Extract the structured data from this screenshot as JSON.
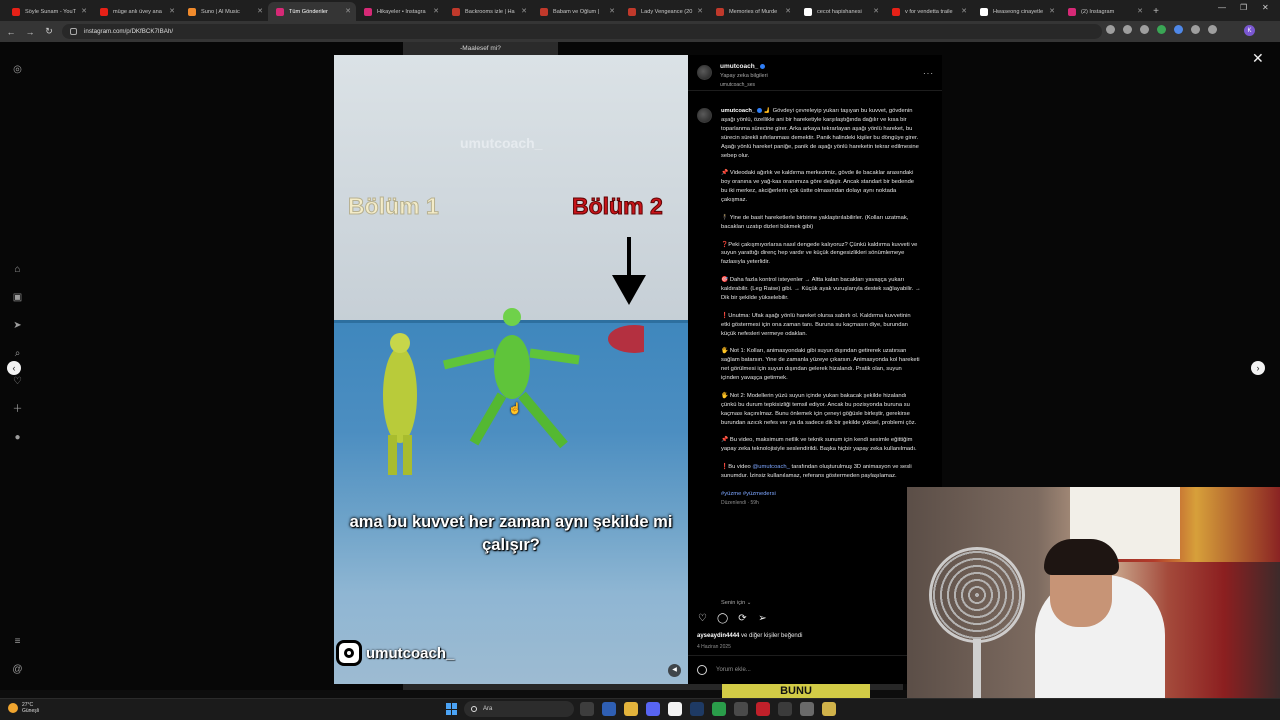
{
  "browser": {
    "tabs": [
      {
        "label": "Söyle Sunam - YouT",
        "color": "#e62117",
        "active": false
      },
      {
        "label": "müge anlı üvey ana",
        "color": "#e62117",
        "active": false
      },
      {
        "label": "Suno | AI Music",
        "color": "#f08a2c",
        "active": false
      },
      {
        "label": "Tüm Gönderiler",
        "color": "#d62976",
        "active": true
      },
      {
        "label": "Hikayeler • Instagra",
        "color": "#d62976",
        "active": false
      },
      {
        "label": "Backrooms izle | Ha",
        "color": "#c0392b",
        "active": false
      },
      {
        "label": "Babam ve Oğlum |",
        "color": "#c0392b",
        "active": false
      },
      {
        "label": "Lady Vengeance (20",
        "color": "#c0392b",
        "active": false
      },
      {
        "label": "Memories of Murde",
        "color": "#c0392b",
        "active": false
      },
      {
        "label": "cecot hapishanesi",
        "color": "#ffffff",
        "active": false
      },
      {
        "label": "v for vendetta traile",
        "color": "#e62117",
        "active": false
      },
      {
        "label": "Hwaseong cinayetle",
        "color": "#ffffff",
        "active": false
      },
      {
        "label": "(2) Instagram",
        "color": "#d62976",
        "active": false
      }
    ],
    "url": "instagram.com/p/DKfBCK7IBAh/",
    "profile_initial": "K"
  },
  "post": {
    "top_caption": "-Maalesef mi?",
    "video": {
      "watermark": "umutcoach_",
      "label_left": "Bölüm 1",
      "label_right": "Bölüm 2",
      "subtitle": "ama bu kuvvet her zaman aynı şekilde mi çalışır?",
      "ig_handle": "umutcoach_"
    },
    "header": {
      "username": "umutcoach_",
      "line2": "Yapay zeka bilgileri",
      "line3": "umutcoach_ses"
    },
    "caption": {
      "username": "umutcoach_",
      "p1": "🫸 Gövdeyi çevreleyip yukarı taşıyan bu kuvvet, gövdenin aşağı yönlü, özellikle ani bir hareketiyle karşılaştığında dağılır ve kısa bir toparlanma sürecine girer. Arka arkaya tekrarlayan aşağı yönlü hareket, bu sürecin sürekli sıfırlanması demektir. Panik halindeki kişiler bu döngüye girer. Aşağı yönlü hareket paniğe, panik de aşağı yönlü hareketin tekrar edilmesine sebep olur.",
      "p2": "📌 Videodaki ağırlık ve kaldırma merkezimiz, gövde ile bacaklar arasındaki boy oranına ve yağ-kas oranımıza göre değişir. Ancak standart bir bedende bu iki merkez, akciğerlerin çok üstte olmasından dolayı aynı noktada çakışmaz.",
      "p3": "🕴 Yine de basit hareketlerle birbirine yaklaştırılabilirler. (Kolları uzatmak, bacakları uzatıp dizleri bükmek gibi)",
      "p4": "❓Peki çakışmıyorlarsa nasıl dengede kalıyoruz? Çünkü kaldırma kuvveti ve suyun yarattığı direnç hep vardır ve küçük dengesizlikleri sönümlemeye fazlasıyla yeterlidir.",
      "p5": "🎯 Daha fazla kontrol isteyenler → Altta kalan bacakları yavaşça yukarı kaldırabilir. (Leg Raise) gibi. → Küçük ayak vuruşlarıyla destek sağlayabilir. → Dik bir şekilde yükselebilir.",
      "p6": "❗Unutma: Ufak aşağı yönlü hareket olursa sabırlı ol. Kaldırma kuvvetinin etki göstermesi için ona zaman tanı. Buruna su kaçmasın diye, burundan küçük nefesleri vermeye odaklan.",
      "p7": "🖐 Not 1: Kolları, animasyondaki gibi suyun dışından getirerek uzatırsan sağlam batarsın. Yine de zamanla yüzeye çıkarsın. Animasyonda kol hareketi net görülmesi için suyun dışından gelerek hizalandı. Pratik olan, suyun içinden yavaşça getirmek.",
      "p8": "🖐 Not 2: Modellerin yüzü suyun içinde yukarı bakacak şekilde hizalandı çünkü bu durum tepkisizliği temsil ediyor. Ancak bu pozisyonda buruna su kaçması kaçınılmaz. Bunu önlemek için çeneyi göğüsle birleştir, gerekirse burundan azıcık nefes ver ya da sadece dik bir şekilde yüksel, problemi çöz.",
      "p9": "📌 Bu video, maksimum netlik ve teknik sunum için kendi sesimle eğittiğim yapay zeka teknolojisiyle seslendirildi. Başka hiçbir yapay zeka kullanılmadı.",
      "p10_pre": "❗Bu video",
      "p10_link": "@umutcoach_",
      "p10_post": "tarafından oluşturulmuş 3D animasyon ve sesli sunumdur. İzinsiz kullanılamaz, referans göstermeden paylaşılamaz.",
      "hashtags": "#yüzme #yüzmedersi",
      "edited": "Düzenlendi · 59h"
    },
    "see_more": "Senin için ⌄",
    "likes_user": "ayseaydin4444",
    "likes_rest": " ve diğer kişiler beğendi",
    "date": "4 Haziran 2025",
    "comment_placeholder": "Yorum ekle...",
    "next_caption": "BUNU"
  },
  "taskbar": {
    "weather_temp": "27°C",
    "weather_desc": "Güneşli",
    "search_label": "Ara"
  }
}
